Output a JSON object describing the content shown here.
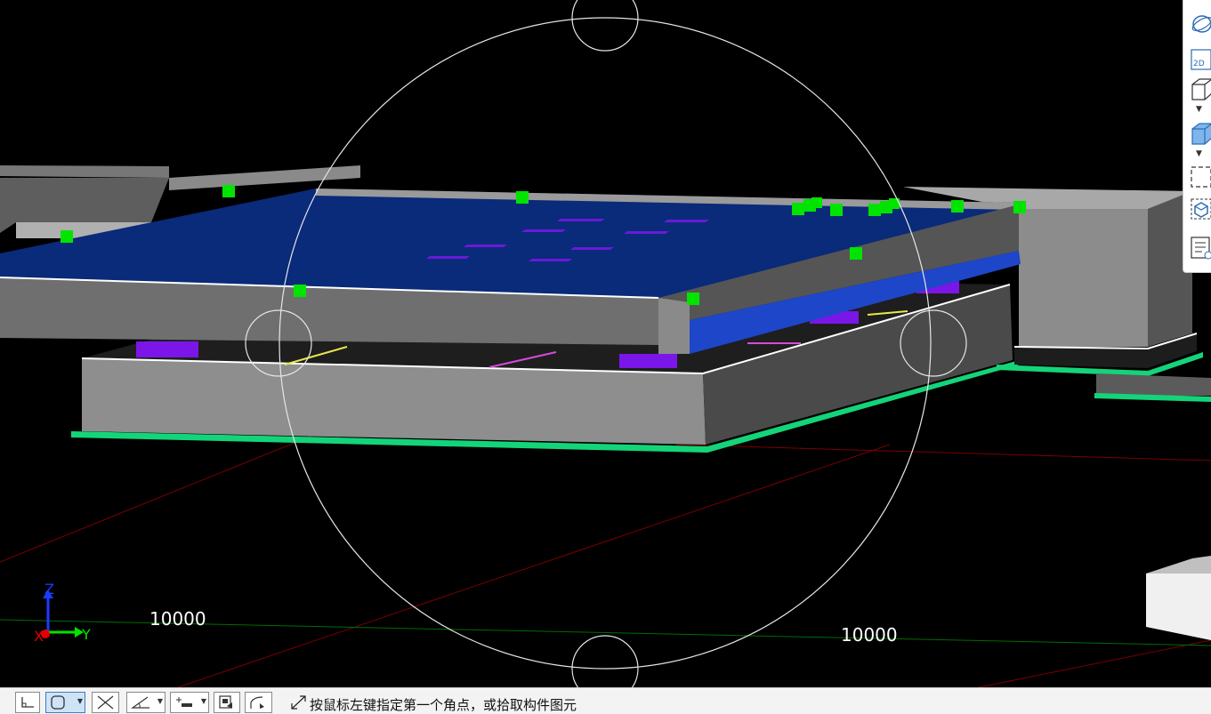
{
  "viewport": {
    "dimension_labels": [
      "10000",
      "10000"
    ],
    "axes": {
      "z": "Z",
      "y": "Y",
      "x": "X"
    },
    "colors": {
      "background": "#000000",
      "slab_blue": "#0a2a7a",
      "beam_gray": "#7a7a7a",
      "column_purple": "#7b16e8",
      "marker_green": "#00e400",
      "outline_green": "#14d47a",
      "axis_red": "#7a0000",
      "axis_green": "#006d00",
      "orbit_ring": "#e6e6e6"
    }
  },
  "right_toolbar": {
    "items": [
      "orbit-icon",
      "2d-icon",
      "3d-box-icon",
      "3d-solid-box-icon",
      "dashed-select-icon",
      "component-view-icon",
      "properties-list-icon"
    ],
    "label_2d": "2D"
  },
  "statusbar": {
    "tools": [
      "orthogonal-mode",
      "snap-object",
      "cross-snap",
      "angle-snap",
      "offset-input",
      "dynamic-input",
      "curve-trace"
    ],
    "prompt": "按鼠标左键指定第一个角点，或拾取构件图元"
  }
}
